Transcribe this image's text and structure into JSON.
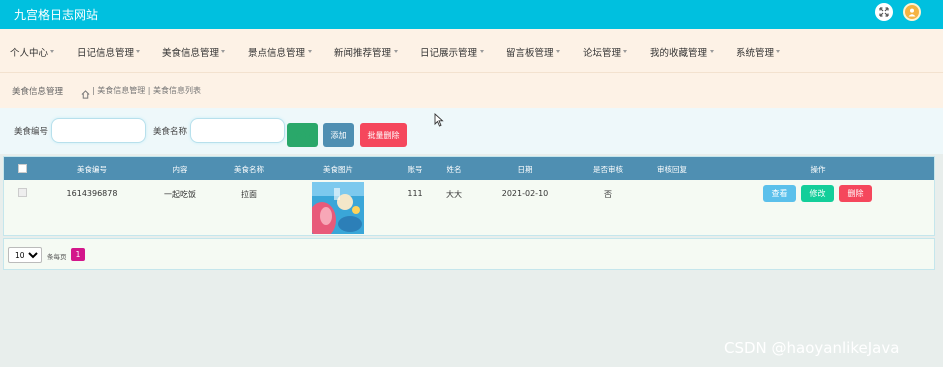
{
  "header": {
    "site_title": "九宫格日志网站"
  },
  "nav": {
    "items": [
      {
        "label": "个人中心"
      },
      {
        "label": "日记信息管理"
      },
      {
        "label": "美食信息管理"
      },
      {
        "label": "景点信息管理"
      },
      {
        "label": "新闻推荐管理"
      },
      {
        "label": "日记展示管理"
      },
      {
        "label": "留言板管理"
      },
      {
        "label": "论坛管理"
      },
      {
        "label": "我的收藏管理"
      },
      {
        "label": "系统管理"
      }
    ]
  },
  "breadcrumb": {
    "title": "美食信息管理",
    "path": "| 美食信息管理 | 美食信息列表"
  },
  "search": {
    "label_id": "美食编号",
    "label_name": "美食名称",
    "input_id_value": "",
    "input_name_value": "",
    "query_label": "查询",
    "add_label": "添加",
    "batch_delete_label": "批量删除"
  },
  "table": {
    "headers": [
      "美食编号",
      "内容",
      "美食名称",
      "美食图片",
      "账号",
      "姓名",
      "日期",
      "是否审核",
      "审核回复",
      "操作"
    ],
    "rows": [
      {
        "id": "1614396878",
        "content": "一起吃饭",
        "name": "拉面",
        "account": "111",
        "person": "大大",
        "date": "2021-02-10",
        "reviewed": "否",
        "reply": "",
        "view_label": "查看",
        "edit_label": "修改",
        "delete_label": "删除"
      }
    ]
  },
  "pager": {
    "page_size": "10",
    "per_page_label": "条每页",
    "current_page": "1"
  },
  "watermark": "CSDN @haoyanlikeJava",
  "colors": {
    "topbar": "#00c0df",
    "nav_bg": "#fdf2e6",
    "table_header": "#4f8fb2",
    "view_btn": "#5bc0eb",
    "edit_btn": "#13ce9a",
    "delete_btn": "#f5475c",
    "page_active": "#d3168b"
  }
}
